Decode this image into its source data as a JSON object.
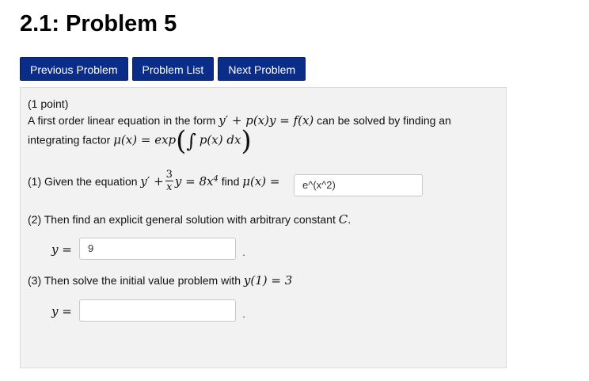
{
  "page": {
    "title": "2.1: Problem 5"
  },
  "nav": {
    "previous_label": "Previous Problem",
    "list_label": "Problem List",
    "next_label": "Next Problem"
  },
  "problem": {
    "points": "(1 point)",
    "intro_prefix": "A first order linear equation in the form",
    "intro_eq": "y′ + p(x)y = f(x)",
    "intro_suffix": "can be solved by finding an",
    "integrating_prefix": "integrating factor",
    "mu_lhs": "μ(x) = exp",
    "integral_sign": "∫",
    "integrand": "p(x) dx",
    "part1_prefix": "(1) Given the equation",
    "part1_y": "y′ +",
    "part1_frac_num": "3",
    "part1_frac_den": "x",
    "part1_rest": "y = 8x",
    "part1_exp": "4",
    "part1_find": "find",
    "part1_mu": "μ(x) =",
    "part1_answer": "e^(x^2)",
    "part2_text": "(2) Then find an explicit general solution with arbitrary constant",
    "part2_const": "C",
    "part2_y_label": "y =",
    "part2_answer": "9",
    "part3_text": "(3) Then solve the initial value problem with",
    "part3_cond": "y(1) = 3",
    "part3_y_label": "y =",
    "part3_answer": "",
    "period": "."
  }
}
